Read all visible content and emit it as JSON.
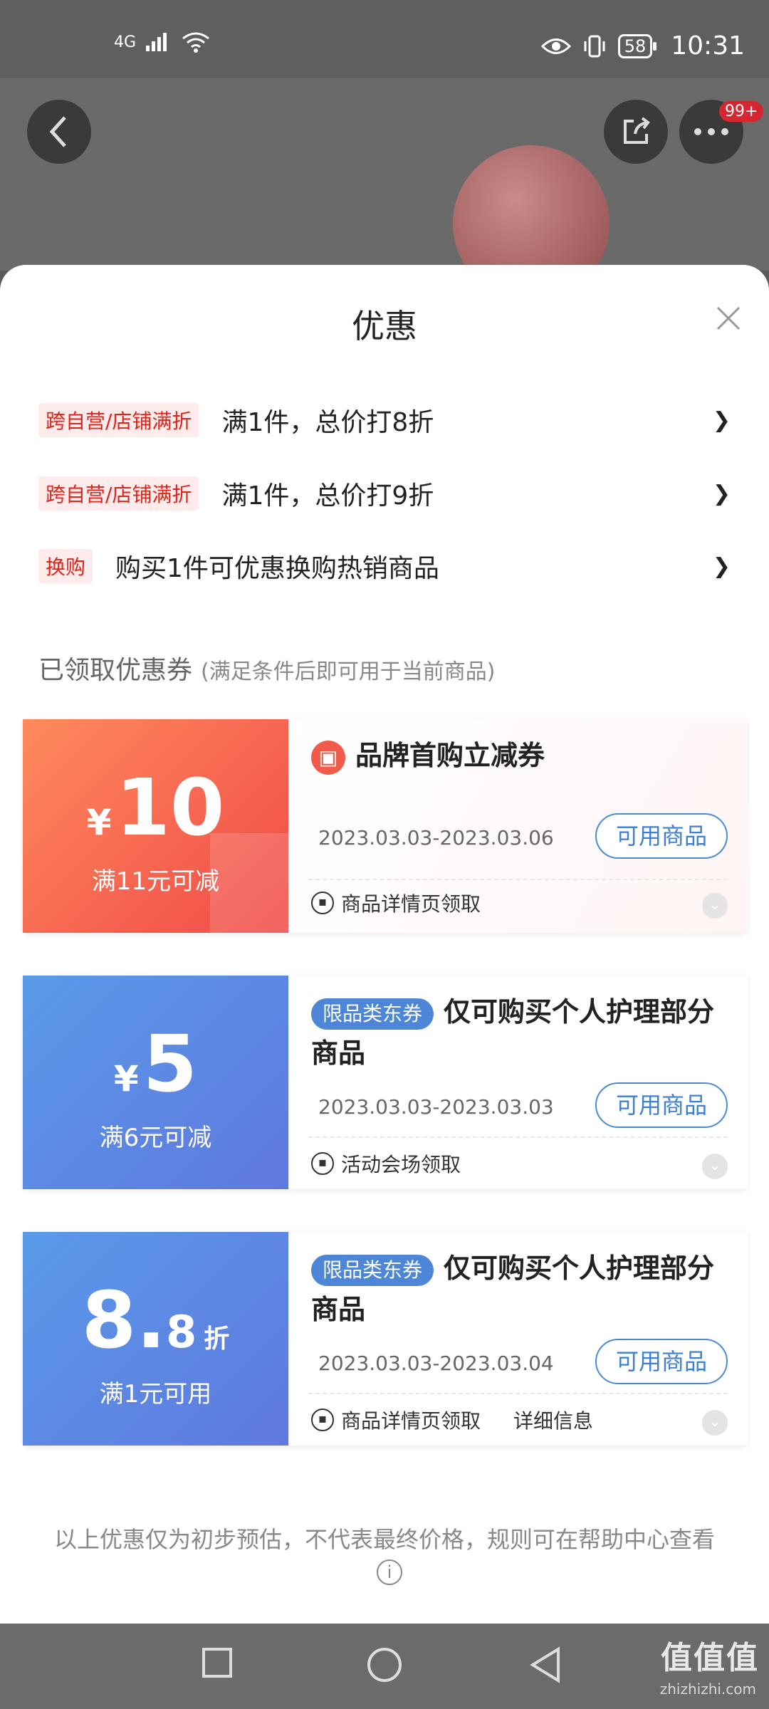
{
  "status_bar": {
    "network": "4G",
    "battery": "58",
    "time": "10:31"
  },
  "header": {
    "badge": "99+"
  },
  "sheet": {
    "title": "优惠",
    "promotions": [
      {
        "tag": "跨自营/店铺满折",
        "text": "满1件，总价打8折",
        "arrow": "❯"
      },
      {
        "tag": "跨自营/店铺满折",
        "text": "满1件，总价打9折",
        "arrow": "❯"
      },
      {
        "tag": "换购",
        "text": "购买1件可优惠换购热销商品",
        "arrow": "❯"
      }
    ],
    "section": {
      "title": "已领取优惠券",
      "subtitle": "(满足条件后即可用于当前商品)"
    },
    "coupons": [
      {
        "currency": "¥",
        "amount": "10",
        "condition": "满11元可减",
        "title": "品牌首购立减券",
        "date": "2023.03.03-2023.03.06",
        "button": "可用商品",
        "source": "商品详情页领取"
      },
      {
        "currency": "¥",
        "amount": "5",
        "condition": "满6元可减",
        "tag": "限品类东券",
        "title": "仅可购买个人护理部分商品",
        "date": "2023.03.03-2023.03.03",
        "button": "可用商品",
        "source": "活动会场领取"
      },
      {
        "amount_int": "8",
        "amount_dot": ".",
        "amount_dec": "8",
        "unit": "折",
        "condition": "满1元可用",
        "tag": "限品类东券",
        "title": "仅可购买个人护理部分商品",
        "date": "2023.03.03-2023.03.04",
        "button": "可用商品",
        "source": "商品详情页领取",
        "more": "详细信息"
      }
    ],
    "footer_note": "以上优惠仅为初步预估，不代表最终价格，规则可在帮助中心查看"
  },
  "watermark": {
    "text": "值值值",
    "sub": "zhizhizhi.com"
  },
  "colors": {
    "accent_red": "#e2231a",
    "coupon_red": "#f04a48",
    "coupon_blue": "#5f78df",
    "button_blue": "#3e7fcf"
  }
}
